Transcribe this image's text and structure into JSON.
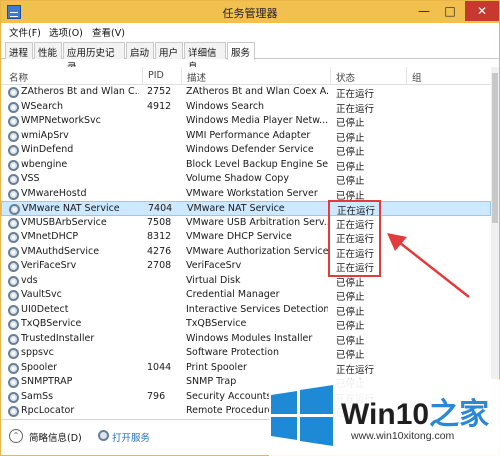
{
  "window": {
    "title": "任务管理器"
  },
  "titlebar_buttons": {
    "minimize": "—",
    "maximize": "□",
    "close": "✕"
  },
  "menu": [
    "文件(F)",
    "选项(O)",
    "查看(V)"
  ],
  "tabs": [
    {
      "label": "进程",
      "active": false
    },
    {
      "label": "性能",
      "active": false
    },
    {
      "label": "应用历史记录",
      "active": false
    },
    {
      "label": "启动",
      "active": false
    },
    {
      "label": "用户",
      "active": false
    },
    {
      "label": "详细信息",
      "active": false
    },
    {
      "label": "服务",
      "active": true
    }
  ],
  "columns": {
    "name": "名称",
    "pid": "PID",
    "desc": "描述",
    "status": "状态",
    "group": "组"
  },
  "services": [
    {
      "name": "ZAtheros Bt and Wlan C...",
      "pid": "2752",
      "desc": "ZAtheros Bt and Wlan Coex A...",
      "status": "正在运行",
      "selected": false
    },
    {
      "name": "WSearch",
      "pid": "4912",
      "desc": "Windows Search",
      "status": "正在运行",
      "selected": false
    },
    {
      "name": "WMPNetworkSvc",
      "pid": "",
      "desc": "Windows Media Player Netw...",
      "status": "已停止",
      "selected": false
    },
    {
      "name": "wmiApSrv",
      "pid": "",
      "desc": "WMI Performance Adapter",
      "status": "已停止",
      "selected": false
    },
    {
      "name": "WinDefend",
      "pid": "",
      "desc": "Windows Defender Service",
      "status": "已停止",
      "selected": false
    },
    {
      "name": "wbengine",
      "pid": "",
      "desc": "Block Level Backup Engine Se...",
      "status": "已停止",
      "selected": false
    },
    {
      "name": "VSS",
      "pid": "",
      "desc": "Volume Shadow Copy",
      "status": "已停止",
      "selected": false
    },
    {
      "name": "VMwareHostd",
      "pid": "",
      "desc": "VMware Workstation Server",
      "status": "已停止",
      "selected": false
    },
    {
      "name": "VMware NAT Service",
      "pid": "7404",
      "desc": "VMware NAT Service",
      "status": "正在运行",
      "selected": true
    },
    {
      "name": "VMUSBArbService",
      "pid": "7508",
      "desc": "VMware USB Arbitration Serv...",
      "status": "正在运行",
      "selected": false
    },
    {
      "name": "VMnetDHCP",
      "pid": "8312",
      "desc": "VMware DHCP Service",
      "status": "正在运行",
      "selected": false
    },
    {
      "name": "VMAuthdService",
      "pid": "4276",
      "desc": "VMware Authorization Service",
      "status": "正在运行",
      "selected": false
    },
    {
      "name": "VeriFaceSrv",
      "pid": "2708",
      "desc": "VeriFaceSrv",
      "status": "正在运行",
      "selected": false
    },
    {
      "name": "vds",
      "pid": "",
      "desc": "Virtual Disk",
      "status": "已停止",
      "selected": false
    },
    {
      "name": "VaultSvc",
      "pid": "",
      "desc": "Credential Manager",
      "status": "已停止",
      "selected": false
    },
    {
      "name": "UI0Detect",
      "pid": "",
      "desc": "Interactive Services Detection",
      "status": "已停止",
      "selected": false
    },
    {
      "name": "TxQBService",
      "pid": "",
      "desc": "TxQBService",
      "status": "已停止",
      "selected": false
    },
    {
      "name": "TrustedInstaller",
      "pid": "",
      "desc": "Windows Modules Installer",
      "status": "已停止",
      "selected": false
    },
    {
      "name": "sppsvc",
      "pid": "",
      "desc": "Software Protection",
      "status": "已停止",
      "selected": false
    },
    {
      "name": "Spooler",
      "pid": "1044",
      "desc": "Print Spooler",
      "status": "正在运行",
      "selected": false
    },
    {
      "name": "SNMPTRAP",
      "pid": "",
      "desc": "SNMP Trap",
      "status": "已停止",
      "selected": false
    },
    {
      "name": "SamSs",
      "pid": "796",
      "desc": "Security Accounts",
      "status": "正在运行",
      "selected": false
    },
    {
      "name": "RpcLocator",
      "pid": "",
      "desc": "Remote Procedure",
      "status": "已停止",
      "selected": false
    }
  ],
  "footer": {
    "fold_label": "简略信息(D)",
    "fold_icon": "chevron-up-icon",
    "open_services": "打开服务"
  },
  "watermark": {
    "brand": "Win10",
    "brand_accent": "之家",
    "url": "www.win10xitong.com"
  },
  "colors": {
    "titlebar": "#f2c04f",
    "selected_row": "#cde8ff",
    "annotation": "#e23b3b",
    "link": "#2a6fb6"
  }
}
